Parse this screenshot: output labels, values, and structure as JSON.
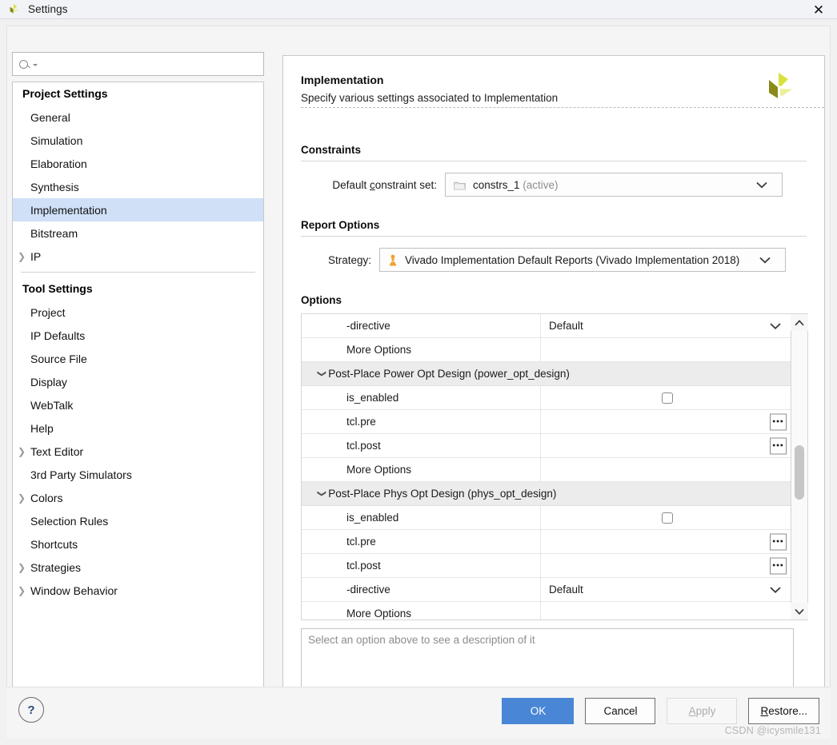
{
  "window": {
    "title": "Settings",
    "close_label": "✕",
    "logo_icon": "xilinx-logo-icon"
  },
  "search": {
    "placeholder": "",
    "value": "",
    "icon": "search-icon"
  },
  "sidebar": {
    "groups": [
      {
        "title": "Project Settings",
        "items": [
          {
            "label": "General",
            "expandable": false,
            "selected": false
          },
          {
            "label": "Simulation",
            "expandable": false,
            "selected": false
          },
          {
            "label": "Elaboration",
            "expandable": false,
            "selected": false
          },
          {
            "label": "Synthesis",
            "expandable": false,
            "selected": false
          },
          {
            "label": "Implementation",
            "expandable": false,
            "selected": true
          },
          {
            "label": "Bitstream",
            "expandable": false,
            "selected": false
          },
          {
            "label": "IP",
            "expandable": true,
            "selected": false
          }
        ]
      },
      {
        "title": "Tool Settings",
        "items": [
          {
            "label": "Project",
            "expandable": false,
            "selected": false
          },
          {
            "label": "IP Defaults",
            "expandable": false,
            "selected": false
          },
          {
            "label": "Source File",
            "expandable": false,
            "selected": false
          },
          {
            "label": "Display",
            "expandable": false,
            "selected": false
          },
          {
            "label": "WebTalk",
            "expandable": false,
            "selected": false
          },
          {
            "label": "Help",
            "expandable": false,
            "selected": false
          },
          {
            "label": "Text Editor",
            "expandable": true,
            "selected": false
          },
          {
            "label": "3rd Party Simulators",
            "expandable": false,
            "selected": false
          },
          {
            "label": "Colors",
            "expandable": true,
            "selected": false
          },
          {
            "label": "Selection Rules",
            "expandable": false,
            "selected": false
          },
          {
            "label": "Shortcuts",
            "expandable": false,
            "selected": false
          },
          {
            "label": "Strategies",
            "expandable": true,
            "selected": false
          },
          {
            "label": "Window Behavior",
            "expandable": true,
            "selected": false
          }
        ]
      }
    ]
  },
  "panel": {
    "title": "Implementation",
    "subtitle": "Specify various settings associated to Implementation",
    "logo_icon": "xilinx-logo-icon",
    "constraints": {
      "heading": "Constraints",
      "field_label_pre": "Default ",
      "field_label_underlined": "c",
      "field_label_post": "onstraint set:",
      "value": "constrs_1",
      "value_suffix": "(active)",
      "icon": "folder-icon"
    },
    "report_options": {
      "heading": "Report Options",
      "field_label": "Strategy:",
      "value": "Vivado Implementation Default Reports (Vivado Implementation 2018)",
      "icon": "strategy-pawn-icon"
    },
    "options": {
      "heading": "Options",
      "rows": [
        {
          "kind": "option",
          "name": "-directive",
          "value_type": "dropdown",
          "value": "Default"
        },
        {
          "kind": "option",
          "name": "More Options",
          "value_type": "empty",
          "value": ""
        },
        {
          "kind": "group",
          "name": "Post-Place Power Opt Design (power_opt_design)",
          "expanded": true
        },
        {
          "kind": "option",
          "name": "is_enabled",
          "value_type": "checkbox",
          "value": "",
          "checked": false
        },
        {
          "kind": "option",
          "name": "tcl.pre",
          "value_type": "browse",
          "value": "",
          "browse_label": "•••"
        },
        {
          "kind": "option",
          "name": "tcl.post",
          "value_type": "browse",
          "value": "",
          "browse_label": "•••"
        },
        {
          "kind": "option",
          "name": "More Options",
          "value_type": "empty",
          "value": ""
        },
        {
          "kind": "group",
          "name": "Post-Place Phys Opt Design (phys_opt_design)",
          "expanded": true
        },
        {
          "kind": "option",
          "name": "is_enabled",
          "value_type": "checkbox",
          "value": "",
          "checked": false
        },
        {
          "kind": "option",
          "name": "tcl.pre",
          "value_type": "browse",
          "value": "",
          "browse_label": "•••"
        },
        {
          "kind": "option",
          "name": "tcl.post",
          "value_type": "browse",
          "value": "",
          "browse_label": "•••"
        },
        {
          "kind": "option",
          "name": "-directive",
          "value_type": "dropdown",
          "value": "Default"
        },
        {
          "kind": "option",
          "name": "More Options",
          "value_type": "empty",
          "value": ""
        }
      ],
      "scrollbar": {
        "up_arrow": "▲",
        "down_arrow": "▼",
        "thumb_top_pct": 42,
        "thumb_height_pct": 20
      }
    },
    "description": {
      "placeholder": "Select an option above to see a description of it",
      "value": ""
    }
  },
  "footer": {
    "help_label": "?",
    "buttons": [
      {
        "id": "ok",
        "label": "OK",
        "style": "primary",
        "enabled": true
      },
      {
        "id": "cancel",
        "label": "Cancel",
        "style": "normal",
        "enabled": true
      },
      {
        "id": "apply",
        "label_pre": "",
        "label_underlined": "A",
        "label_post": "pply",
        "style": "disabled",
        "enabled": false
      },
      {
        "id": "restore",
        "label_pre": "",
        "label_underlined": "R",
        "label_post": "estore...",
        "style": "normal",
        "enabled": true
      }
    ],
    "watermark": "CSDN @icysmile131"
  },
  "colors": {
    "accent": "#4a86d6",
    "selection": "#cfe0f7",
    "logo_dark": "#8a8a18",
    "logo_light": "#d8e23f",
    "pawn": "#f0a030"
  }
}
